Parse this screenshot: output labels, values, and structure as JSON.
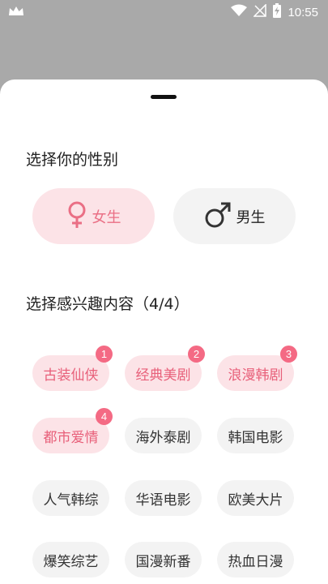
{
  "status_bar": {
    "time": "10:55",
    "icons": [
      "crown-icon",
      "wifi-icon",
      "no-signal-icon",
      "battery-charging-icon"
    ]
  },
  "sheet": {
    "gender_title": "选择你的性别",
    "genders": [
      {
        "label": "女生",
        "icon": "female-symbol-icon",
        "selected": true
      },
      {
        "label": "男生",
        "icon": "male-symbol-icon",
        "selected": false
      }
    ],
    "interest_title": "选择感兴趣内容（4/4）",
    "interests": [
      {
        "label": "古装仙侠",
        "selected": true,
        "badge": "1"
      },
      {
        "label": "经典美剧",
        "selected": true,
        "badge": "2"
      },
      {
        "label": "浪漫韩剧",
        "selected": true,
        "badge": "3"
      },
      {
        "label": "都市爱情",
        "selected": true,
        "badge": "4"
      },
      {
        "label": "海外泰剧",
        "selected": false,
        "badge": ""
      },
      {
        "label": "韩国电影",
        "selected": false,
        "badge": ""
      },
      {
        "label": "人气韩综",
        "selected": false,
        "badge": ""
      },
      {
        "label": "华语电影",
        "selected": false,
        "badge": ""
      },
      {
        "label": "欧美大片",
        "selected": false,
        "badge": ""
      },
      {
        "label": "爆笑综艺",
        "selected": false,
        "badge": ""
      },
      {
        "label": "国漫新番",
        "selected": false,
        "badge": ""
      },
      {
        "label": "热血日漫",
        "selected": false,
        "badge": ""
      }
    ]
  },
  "colors": {
    "accent": "#f46a84",
    "selected_bg": "#fce3e7",
    "unselected_bg": "#f3f3f3",
    "overlay": "#a9a9a9"
  }
}
